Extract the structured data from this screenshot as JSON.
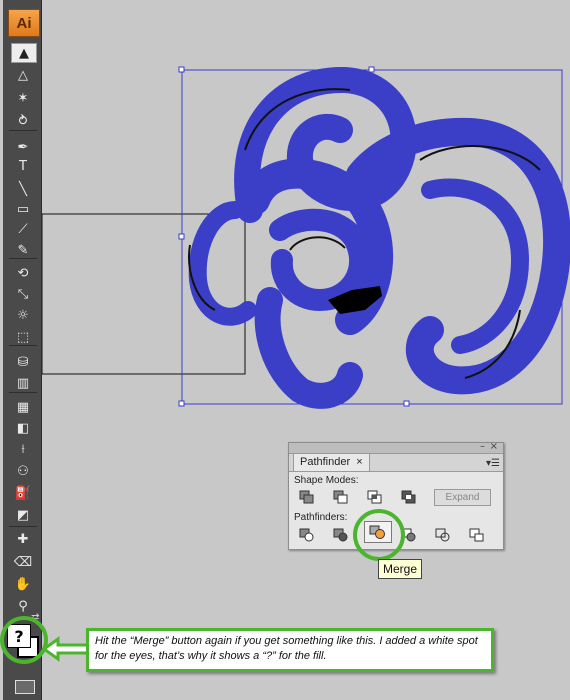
{
  "app": {
    "logo": "Ai"
  },
  "toolbar": {
    "tools": [
      {
        "name": "selection-tool",
        "glyph": "▲"
      },
      {
        "name": "direct-selection-tool",
        "glyph": "△"
      },
      {
        "name": "magic-wand-tool",
        "glyph": "✶"
      },
      {
        "name": "lasso-tool",
        "glyph": "⥁"
      },
      {
        "name": "pen-tool",
        "glyph": "✒"
      },
      {
        "name": "type-tool",
        "glyph": "T"
      },
      {
        "name": "line-tool",
        "glyph": "╲"
      },
      {
        "name": "rectangle-tool",
        "glyph": "▭"
      },
      {
        "name": "paintbrush-tool",
        "glyph": "⟋"
      },
      {
        "name": "pencil-tool",
        "glyph": "✎"
      },
      {
        "name": "rotate-tool",
        "glyph": "⟲"
      },
      {
        "name": "scale-tool",
        "glyph": "⤡"
      },
      {
        "name": "warp-tool",
        "glyph": "☼"
      },
      {
        "name": "free-transform-tool",
        "glyph": "⬚"
      },
      {
        "name": "symbol-sprayer-tool",
        "glyph": "⛁"
      },
      {
        "name": "graph-tool",
        "glyph": "▥"
      },
      {
        "name": "mesh-tool",
        "glyph": "▦"
      },
      {
        "name": "gradient-tool",
        "glyph": "◧"
      },
      {
        "name": "eyedropper-tool",
        "glyph": "⟊"
      },
      {
        "name": "blend-tool",
        "glyph": "⚇"
      },
      {
        "name": "live-paint-bucket-tool",
        "glyph": "⛽"
      },
      {
        "name": "live-paint-selection-tool",
        "glyph": "◩"
      },
      {
        "name": "slice-tool",
        "glyph": "✚"
      },
      {
        "name": "eraser-tool",
        "glyph": "⌫"
      },
      {
        "name": "hand-tool",
        "glyph": "✋"
      },
      {
        "name": "zoom-tool",
        "glyph": "⚲"
      }
    ],
    "fill_glyph": "?"
  },
  "pathfinder": {
    "tab": "Pathfinder",
    "tab_close": "×",
    "shape_modes_label": "Shape Modes:",
    "expand_label": "Expand",
    "pathfinders_label": "Pathfinders:",
    "menu_glyph": "▾☰",
    "collapse_glyph": "«",
    "close_glyph": "×",
    "minimize_glyph": "–"
  },
  "tooltip": {
    "text": "Merge"
  },
  "callout": {
    "text": "Hit the “Merge” button again if you get something like this.  I added a white spot for the eyes, that’s why it shows a “?” for the fill."
  },
  "colors": {
    "artwork": "#3b3fc8",
    "highlight": "#4bb52d",
    "selection": "#3a3ad0"
  }
}
